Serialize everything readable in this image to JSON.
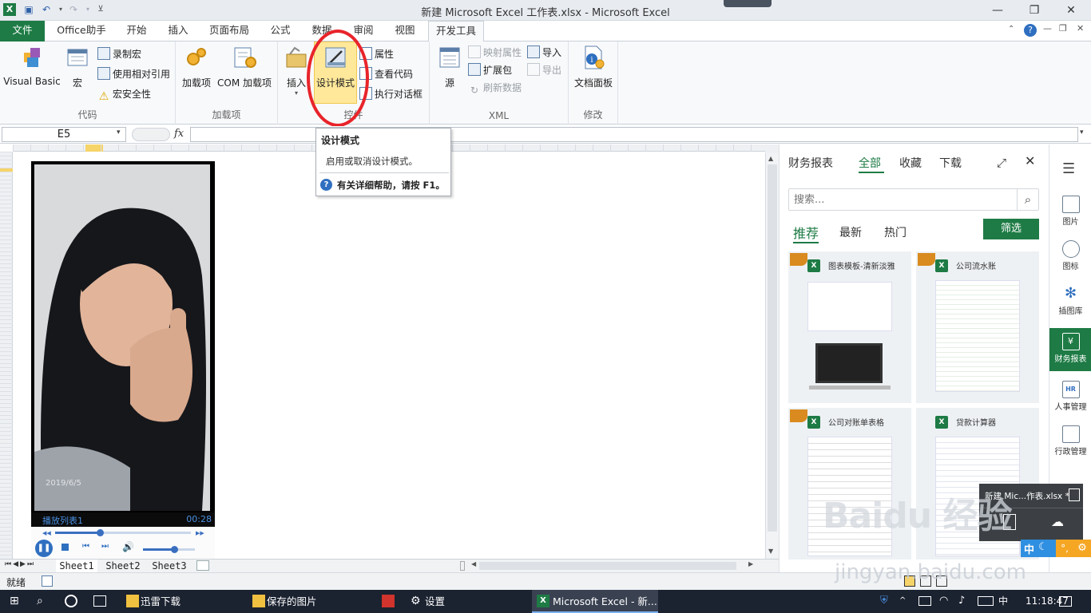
{
  "window": {
    "title": "新建 Microsoft Excel 工作表.xlsx - Microsoft Excel",
    "minimize_icon": "minimize-icon",
    "restore_icon": "restore-icon",
    "close_icon": "close-icon"
  },
  "ribbon_tabs": [
    "文件",
    "Office助手",
    "开始",
    "插入",
    "页面布局",
    "公式",
    "数据",
    "审阅",
    "视图",
    "开发工具"
  ],
  "active_tab": "开发工具",
  "ribbon": {
    "code": {
      "label": "代码",
      "visual_basic": "Visual Basic",
      "macro": "宏",
      "record_macro": "录制宏",
      "relative_ref": "使用相对引用",
      "macro_security": "宏安全性"
    },
    "addins": {
      "label": "加载项",
      "addins": "加载项",
      "com_addins": "COM 加载项"
    },
    "controls": {
      "label": "控件",
      "insert": "插入",
      "design_mode": "设计模式",
      "properties": "属性",
      "view_code": "查看代码",
      "run_dialog": "执行对话框"
    },
    "xml": {
      "label": "XML",
      "source": "源",
      "map_properties": "映射属性",
      "expansion_packs": "扩展包",
      "refresh_data": "刷新数据",
      "import": "导入",
      "export": "导出"
    },
    "modify": {
      "label": "修改",
      "doc_panel": "文档面板"
    }
  },
  "formula_bar": {
    "name_box": "E5",
    "fx": "fx",
    "value": ""
  },
  "tooltip": {
    "title": "设计模式",
    "desc": "启用或取消设计模式。",
    "help": "有关详细帮助，请按 F1。"
  },
  "video": {
    "date": "2019/6/5",
    "playlist": "播放列表1",
    "time": "00:28",
    "progress": 0.33,
    "volume": 0.6
  },
  "sheets": [
    "Sheet1",
    "Sheet2",
    "Sheet3"
  ],
  "status": {
    "ready": "就绪"
  },
  "pane": {
    "tabs": [
      "财务报表",
      "全部",
      "收藏",
      "下载"
    ],
    "active_tab": "全部",
    "search_placeholder": "搜索...",
    "filters": [
      "推荐",
      "最新",
      "热门"
    ],
    "active_filter": "推荐",
    "filter_button": "筛选",
    "cards": [
      {
        "title": "图表模板-清新淡雅"
      },
      {
        "title": "公司流水账"
      },
      {
        "title": "公司对账单表格"
      },
      {
        "title": "贷款计算器"
      }
    ]
  },
  "right_bar": [
    "图片",
    "图标",
    "插图库",
    "财务报表",
    "人事管理",
    "行政管理"
  ],
  "right_bar_active": "财务报表",
  "toast": {
    "filename": "新建 Mic...作表.xlsx *"
  },
  "ime": {
    "lang": "中"
  },
  "watermark": {
    "text": "Baidu 经验",
    "url": "jingyan.baidu.com"
  },
  "taskbar": {
    "items": [
      "迅雷下载",
      "保存的图片",
      "设置",
      "Microsoft Excel - 新..."
    ],
    "clock": "11:18:47"
  },
  "colors": {
    "excel_green": "#1e7b45",
    "highlight": "#ffe89a",
    "annotation_red": "#e8242a"
  }
}
